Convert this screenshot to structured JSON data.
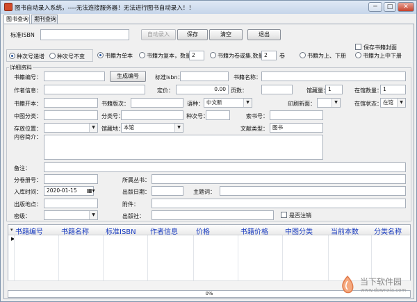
{
  "title_bar": {
    "title": "图书自动录入系统，----无法连接服务器！无法进行图书自动录入！！",
    "minimize": "─",
    "maximize": "□",
    "close": "✕"
  },
  "tabs": [
    {
      "label": "图书查询"
    },
    {
      "label": "期刊查询"
    }
  ],
  "isbn": {
    "label": "标准ISBN",
    "value": "",
    "auto_button": "自动录入",
    "save_button": "保存",
    "clear_button": "清空",
    "exit_button": "退出",
    "save_cover": "保存书籍封面"
  },
  "mode_radios": {
    "increment": "种次号递增",
    "constant": "种次号不变"
  },
  "volume_radios": {
    "single": "书籍为单本",
    "copies": "书籍为复本，数量",
    "copies_count": "2",
    "volumes": "书籍为卷或集,数量",
    "volumes_count": "2",
    "volumes_unit": "卷",
    "up_down": "书籍为上、下册",
    "up_mid_down": "书籍为上中下册"
  },
  "details": {
    "group_label": "详细资料",
    "book_code_label": "书籍编号：",
    "book_code": "",
    "generate_button": "生成编号",
    "isbn_label": "标准isbn：",
    "isbn": "",
    "book_name_label": "书籍名称：",
    "book_name": "",
    "author_label": "作者信息：",
    "author": "",
    "price_label": "定价：",
    "price": "0.00",
    "pages_label": "页数：",
    "pages": "",
    "stock_label": "馆藏量：",
    "stock": "1",
    "onshelf_label": "在馆数量：",
    "onshelf": "1",
    "format_label": "书籍开本：",
    "format": "",
    "edition_label": "书籍版次：",
    "edition": "",
    "language_label": "语种：",
    "language": "中文新",
    "print_label": "印刷新面：",
    "print": "",
    "status_label": "在馆状态：",
    "status": "在馆",
    "clc_label": "中图分类：",
    "clc": "",
    "category_label": "分类号：",
    "category": "",
    "species_label": "种次号：",
    "species": "",
    "call_label": "索书号：",
    "call": "",
    "location_label": "存放位置：",
    "location": "",
    "collection_label": "馆藏地：",
    "collection": "本馆",
    "doc_type_label": "文献类型：",
    "doc_type": "图书",
    "summary_label": "内容简介：",
    "summary": "",
    "remark_label": "备注：",
    "remark": "",
    "volume_no_label": "分卷册号：",
    "volume_no": "",
    "series_label": "所属丛书：",
    "series": "",
    "entry_date_label": "入库时间：",
    "entry_date": "2020-01-15",
    "pub_date_label": "出版日期：",
    "pub_date": "",
    "subject_label": "主题词：",
    "subject": "",
    "pub_place_label": "出版地点：",
    "pub_place": "",
    "attachment_label": "附件：",
    "attachment": "",
    "secret_label": "密级：",
    "secret": "",
    "publisher_label": "出版社：",
    "publisher": "",
    "cancelled_label": "是否注销"
  },
  "grid": {
    "columns": [
      "书籍编号",
      "书籍名称",
      "标准ISBN",
      "作者信息",
      "价格",
      "书籍价格",
      "中图分类",
      "当前本数",
      "分类名称"
    ]
  },
  "status": {
    "progress_text": "0%",
    "progress": 0
  },
  "watermark": {
    "brand": "当下软件园",
    "url": "www.downxia.com"
  },
  "colors": {
    "header_text": "#1a3cc0",
    "accent": "#1f4f9a"
  }
}
